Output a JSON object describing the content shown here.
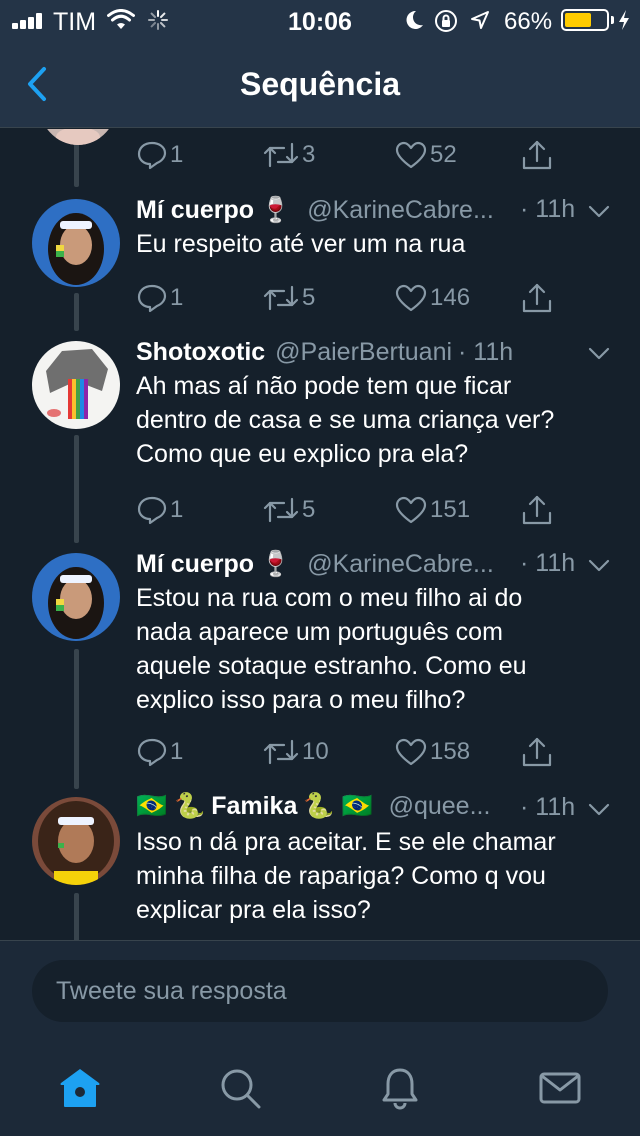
{
  "status_bar": {
    "carrier": "TIM",
    "time": "10:06",
    "battery_text": "66%",
    "battery_level": 0.66,
    "battery_color": "#ffcc00",
    "icons": [
      "signal-icon",
      "wifi-icon",
      "activity-icon",
      "moon-icon",
      "orientation-lock-icon",
      "location-icon",
      "battery-icon",
      "charging-bolt-icon"
    ]
  },
  "nav": {
    "title": "Sequência",
    "back_icon": "chevron-left-icon",
    "accent": "#1da1f2"
  },
  "top_actions": {
    "reply_count": "1",
    "retweet_count": "3",
    "like_count": "52"
  },
  "tweets": [
    {
      "name": "Mí cuerpo",
      "emoji": "🍷",
      "handle": "@KarineCabre...",
      "time": "· 11h",
      "lines": [
        "Eu respeito até ver um na rua"
      ],
      "reply_count": "1",
      "retweet_count": "5",
      "like_count": "146"
    },
    {
      "name": "Shotoxotic",
      "handle": "@PaierBertuani",
      "time": "· 11h",
      "lines": [
        "Ah mas aí não pode tem que ficar",
        "dentro de casa e se uma criança ver?",
        "Como que eu explico pra ela?"
      ],
      "reply_count": "1",
      "retweet_count": "5",
      "like_count": "151"
    },
    {
      "name": "Mí cuerpo",
      "emoji": "🍷",
      "handle": "@KarineCabre...",
      "time": "· 11h",
      "lines": [
        "Estou na rua com o meu filho ai do",
        "nada aparece um português com",
        "aquele sotaque estranho. Como eu",
        "explico isso para o meu filho?"
      ],
      "reply_count": "1",
      "retweet_count": "10",
      "like_count": "158"
    },
    {
      "name": "Famika",
      "name_prefix": "🇧🇷 🐍",
      "name_suffix": "🐍 🇧🇷",
      "handle": "@quee...",
      "time": "· 11h",
      "lines": [
        "Isso n dá pra aceitar. E se ele chamar",
        "minha filha de rapariga? Como q vou",
        "explicar pra ela isso?"
      ]
    }
  ],
  "reply_box": {
    "placeholder": "Tweete sua resposta"
  },
  "tab_bar": {
    "tabs": [
      "home-icon",
      "search-icon",
      "notifications-icon",
      "messages-icon"
    ],
    "active": "home-icon"
  }
}
